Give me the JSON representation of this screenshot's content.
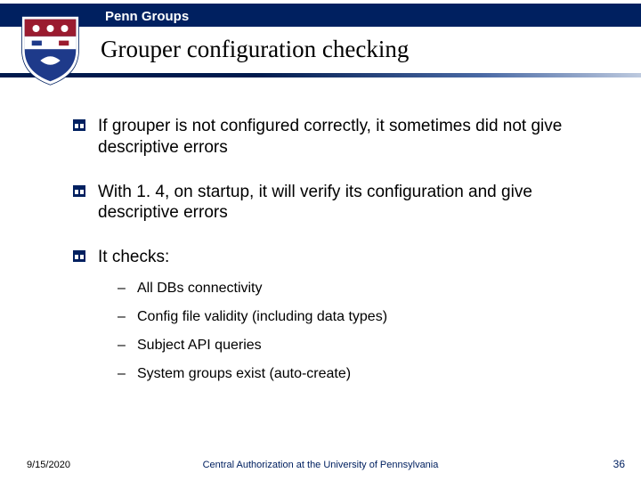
{
  "header": {
    "brand": "Penn Groups"
  },
  "title": "Grouper configuration checking",
  "bullets": [
    {
      "text": "If grouper is not configured correctly, it sometimes did not give descriptive errors"
    },
    {
      "text": "With 1. 4, on startup, it will verify its configuration and give descriptive errors"
    },
    {
      "text": "It checks:",
      "sub": [
        "All DBs connectivity",
        "Config file validity (including data types)",
        "Subject API queries",
        "System groups exist (auto-create)"
      ]
    }
  ],
  "footer": {
    "date": "9/15/2020",
    "center": "Central Authorization at the University of Pennsylvania",
    "page": "36"
  },
  "colors": {
    "navy": "#002060",
    "red": "#9a1b2f",
    "blue_shield": "#1e3a8a"
  }
}
